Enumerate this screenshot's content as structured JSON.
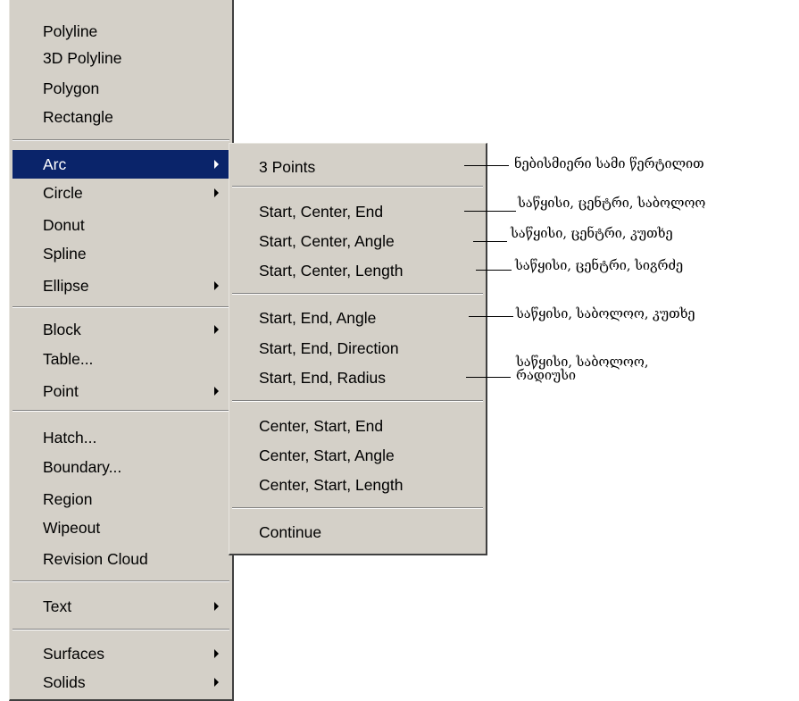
{
  "main_menu": {
    "items": [
      {
        "label": "Polyline"
      },
      {
        "label": "3D Polyline"
      },
      {
        "label": "Polygon"
      },
      {
        "label": "Rectangle"
      },
      {
        "label": "Arc",
        "submenu": true,
        "selected": true
      },
      {
        "label": "Circle",
        "submenu": true
      },
      {
        "label": "Donut"
      },
      {
        "label": "Spline"
      },
      {
        "label": "Ellipse",
        "submenu": true
      },
      {
        "label": "Block",
        "submenu": true
      },
      {
        "label": "Table..."
      },
      {
        "label": "Point",
        "submenu": true
      },
      {
        "label": "Hatch..."
      },
      {
        "label": "Boundary..."
      },
      {
        "label": "Region"
      },
      {
        "label": "Wipeout"
      },
      {
        "label": "Revision Cloud"
      },
      {
        "label": "Text",
        "submenu": true
      },
      {
        "label": "Surfaces",
        "submenu": true
      },
      {
        "label": "Solids",
        "submenu": true
      }
    ]
  },
  "arc_submenu": {
    "items": [
      {
        "label": "3 Points"
      },
      {
        "label": "Start, Center, End"
      },
      {
        "label": "Start, Center, Angle"
      },
      {
        "label": "Start, Center, Length"
      },
      {
        "label": "Start, End, Angle"
      },
      {
        "label": "Start, End, Direction"
      },
      {
        "label": "Start, End, Radius"
      },
      {
        "label": "Center, Start, End"
      },
      {
        "label": "Center, Start, Angle"
      },
      {
        "label": "Center, Start, Length"
      },
      {
        "label": "Continue"
      }
    ]
  },
  "annotations": [
    {
      "text": "ნებისმიერი სამი წერტილით"
    },
    {
      "text": "საწყისი, ცენტრი, საბოლოო"
    },
    {
      "text": "საწყისი, ცენტრი, კუთხე"
    },
    {
      "text": "საწყისი, ცენტრი, სიგრძე"
    },
    {
      "text": "საწყისი, საბოლოო, კუთხე"
    },
    {
      "text": "საწყისი, საბოლოო,"
    },
    {
      "text": "რადიუსი"
    }
  ],
  "colors": {
    "menu_bg": "#d4d0c8",
    "selection_bg": "#0a246a",
    "selection_text": "#ffffff"
  }
}
